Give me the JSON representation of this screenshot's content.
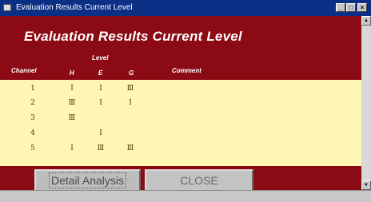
{
  "window": {
    "title": "Evaluation Results Current Level",
    "controls": {
      "minimize": "_",
      "maximize": "□",
      "close": "×"
    }
  },
  "form": {
    "heading": "Evaluation Results Current Level",
    "headers": {
      "level": "Level",
      "channel": "Channel",
      "h": "H",
      "e": "E",
      "g": "G",
      "comment": "Comment"
    },
    "rows": [
      {
        "channel": "1",
        "h": "Ⅰ",
        "e": "Ⅰ",
        "g": "Ⅲ"
      },
      {
        "channel": "2",
        "h": "Ⅲ",
        "e": "Ⅰ",
        "g": "Ⅰ"
      },
      {
        "channel": "3",
        "h": "Ⅲ",
        "e": "",
        "g": ""
      },
      {
        "channel": "4",
        "h": "",
        "e": "Ⅰ",
        "g": ""
      },
      {
        "channel": "5",
        "h": "Ⅰ",
        "e": "Ⅲ",
        "g": "Ⅲ"
      }
    ],
    "buttons": {
      "detail": "Detail Analysis",
      "close": "CLOSE"
    }
  },
  "colors": {
    "title_bar": "#0c2f86",
    "form_background": "#8b0a14",
    "row_background": "#fff6b4"
  }
}
